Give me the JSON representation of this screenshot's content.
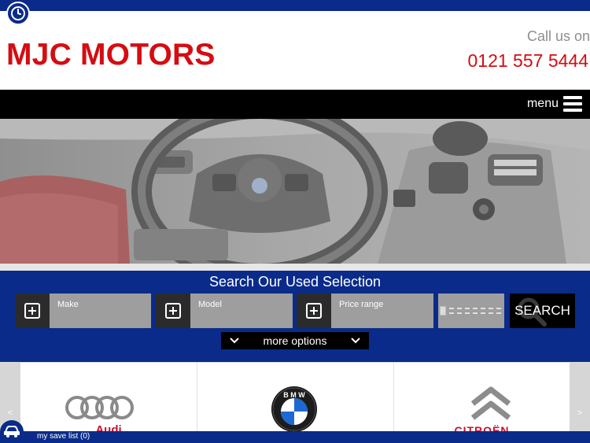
{
  "header": {
    "logo": "MJC MOTORS",
    "call_label": "Call us on",
    "phone": "0121 557 5444"
  },
  "nav": {
    "menu_label": "menu"
  },
  "search": {
    "title": "Search Our Used Selection",
    "make_label": "Make",
    "model_label": "Model",
    "price_label": "Price range",
    "search_label": "SEARCH",
    "more_options_label": "more options"
  },
  "brands": {
    "prev_label": "<",
    "next_label": ">",
    "items": [
      {
        "name": "Audi",
        "icon": "audi-logo"
      },
      {
        "name": "BMW",
        "icon": "bmw-logo"
      },
      {
        "name": "CITROËN",
        "icon": "citroen-logo"
      }
    ]
  },
  "footer": {
    "save_list_label": "my save list (0)"
  },
  "colors": {
    "brand_red": "#d40d12",
    "navy": "#0a2b8a",
    "black": "#000000",
    "panel_grey": "#9e9e9e"
  }
}
